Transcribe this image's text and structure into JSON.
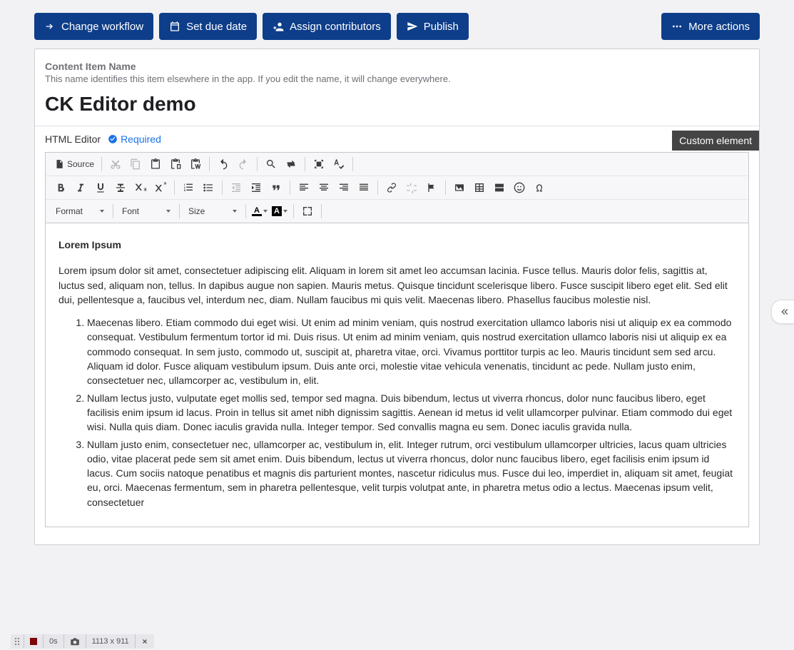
{
  "buttons": {
    "change_workflow": "Change workflow",
    "set_due_date": "Set due date",
    "assign_contributors": "Assign contributors",
    "publish": "Publish",
    "more_actions": "More actions"
  },
  "name_section": {
    "label": "Content Item Name",
    "description": "This name identifies this item elsewhere in the app. If you edit the name, it will change everywhere.",
    "title": "CK Editor demo"
  },
  "editor": {
    "label": "HTML Editor",
    "required": "Required",
    "custom_element": "Custom element",
    "source_btn": "Source",
    "format": "Format",
    "font": "Font",
    "size": "Size",
    "letter_a": "A"
  },
  "content": {
    "heading": "Lorem Ipsum",
    "paragraph": "Lorem ipsum dolor sit amet, consectetuer adipiscing elit. Aliquam in lorem sit amet leo accumsan lacinia. Fusce tellus. Mauris dolor felis, sagittis at, luctus sed, aliquam non, tellus. In dapibus augue non sapien. Mauris metus. Quisque tincidunt scelerisque libero. Fusce suscipit libero eget elit. Sed elit dui, pellentesque a, faucibus vel, interdum nec, diam. Nullam faucibus mi quis velit. Maecenas libero. Phasellus faucibus molestie nisl.",
    "items": [
      "Maecenas libero. Etiam commodo dui eget wisi. Ut enim ad minim veniam, quis nostrud exercitation ullamco laboris nisi ut aliquip ex ea commodo consequat. Vestibulum fermentum tortor id mi. Duis risus. Ut enim ad minim veniam, quis nostrud exercitation ullamco laboris nisi ut aliquip ex ea commodo consequat. In sem justo, commodo ut, suscipit at, pharetra vitae, orci. Vivamus porttitor turpis ac leo. Mauris tincidunt sem sed arcu. Aliquam id dolor. Fusce aliquam vestibulum ipsum. Duis ante orci, molestie vitae vehicula venenatis, tincidunt ac pede. Nullam justo enim, consectetuer nec, ullamcorper ac, vestibulum in, elit.",
      "Nullam lectus justo, vulputate eget mollis sed, tempor sed magna. Duis bibendum, lectus ut viverra rhoncus, dolor nunc faucibus libero, eget facilisis enim ipsum id lacus. Proin in tellus sit amet nibh dignissim sagittis. Aenean id metus id velit ullamcorper pulvinar. Etiam commodo dui eget wisi. Nulla quis diam. Donec iaculis gravida nulla. Integer tempor. Sed convallis magna eu sem. Donec iaculis gravida nulla.",
      "Nullam justo enim, consectetuer nec, ullamcorper ac, vestibulum in, elit. Integer rutrum, orci vestibulum ullamcorper ultricies, lacus quam ultricies odio, vitae placerat pede sem sit amet enim. Duis bibendum, lectus ut viverra rhoncus, dolor nunc faucibus libero, eget facilisis enim ipsum id lacus. Cum sociis natoque penatibus et magnis dis parturient montes, nascetur ridiculus mus. Fusce dui leo, imperdiet in, aliquam sit amet, feugiat eu, orci. Maecenas fermentum, sem in pharetra pellentesque, velit turpis volutpat ante, in pharetra metus odio a lectus. Maecenas ipsum velit, consectetuer"
    ]
  },
  "status": {
    "time": "0s",
    "dimensions": "1113 x 911"
  }
}
